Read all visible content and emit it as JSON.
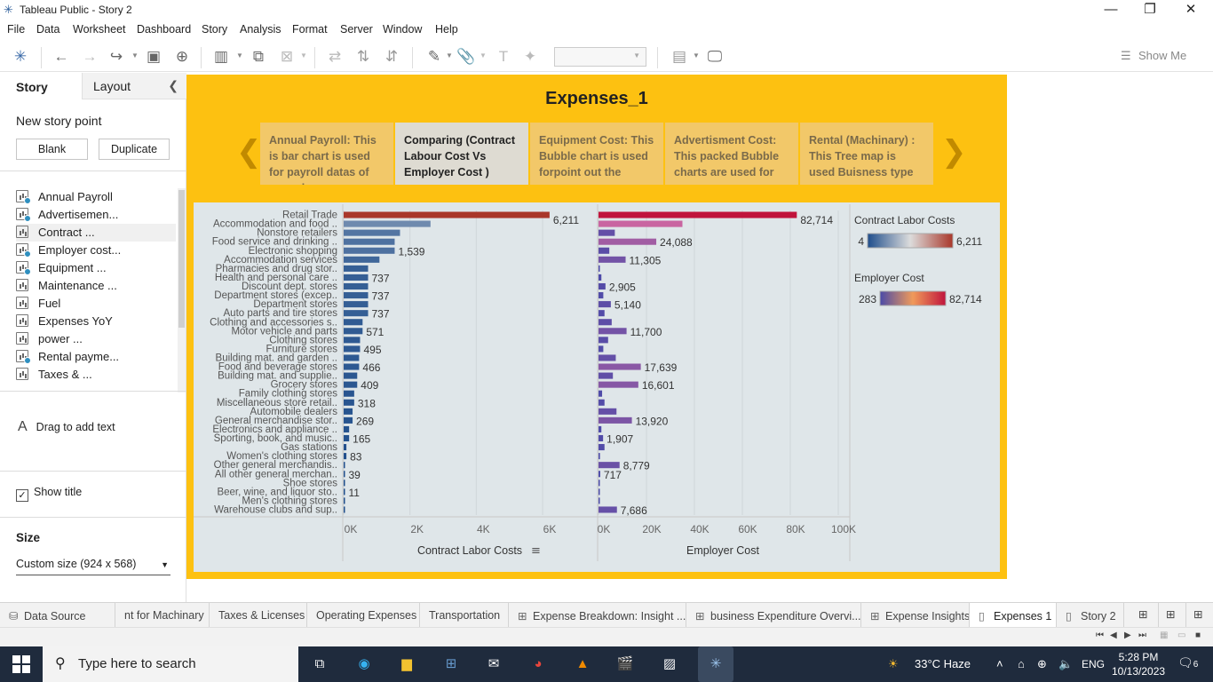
{
  "window": {
    "title": "Tableau Public - Story 2",
    "minimize": "—",
    "restore": "❐",
    "close": "✕"
  },
  "menu": [
    "File",
    "Data",
    "Worksheet",
    "Dashboard",
    "Story",
    "Analysis",
    "Format",
    "Server",
    "Window",
    "Help"
  ],
  "toolbar": {
    "show_me": "Show Me"
  },
  "leftpane": {
    "tab_story": "Story",
    "tab_layout": "Layout",
    "new_story_point": "New story point",
    "blank_button": "Blank",
    "duplicate_button": "Duplicate",
    "sheets": [
      {
        "label": "Annual Payroll",
        "checked": true
      },
      {
        "label": "Advertisemen...",
        "checked": true
      },
      {
        "label": "Contract ...",
        "checked": false
      },
      {
        "label": "Employer cost...",
        "checked": true
      },
      {
        "label": "Equipment ...",
        "checked": true
      },
      {
        "label": "Maintenance ...",
        "checked": false
      },
      {
        "label": "Fuel",
        "checked": false
      },
      {
        "label": "Expenses YoY",
        "checked": false
      },
      {
        "label": "power ...",
        "checked": false
      },
      {
        "label": "Rental payme...",
        "checked": true
      },
      {
        "label": "Taxes & ...",
        "checked": false
      }
    ],
    "drag_text": "Drag to add text",
    "drag_icon": "A",
    "show_title": "Show title",
    "size_label": "Size",
    "size_value": "Custom size (924 x 568)"
  },
  "story": {
    "title": "Expenses_1",
    "points": [
      {
        "text": "Annual Payroll:  This is bar chart is used for payroll datas of annual",
        "active": false
      },
      {
        "text": "Comparing (Contract Labour Cost  Vs Employer Cost )",
        "active": true
      },
      {
        "text": "Equipment Cost:  This Bubble chart is used forpoint out the",
        "active": false
      },
      {
        "text": "Advertisment Cost: This packed Bubble charts are used for",
        "active": false
      },
      {
        "text": "Rental  (Machinary) : This  Tree map is used Buisness type",
        "active": false
      }
    ],
    "prev_arrow": "❮",
    "next_arrow": "❯"
  },
  "chart_data": {
    "type": "bar",
    "categories": [
      "Retail Trade",
      "Accommodation and food ..",
      "Nonstore retailers",
      "Food service and drinking ..",
      "Electronic shopping",
      "Accommodation services",
      "Pharmacies and drug stor..",
      "Health and personal care ..",
      "Discount dept. stores",
      "Department stores (excep..",
      "Department stores",
      "Auto parts and tire stores",
      "Clothing and accessories s..",
      "Motor vehicle and parts",
      "Clothing stores",
      "Furniture stores",
      "Building mat. and garden ..",
      "Food and beverage stores",
      "Building mat. and supplie..",
      "Grocery stores",
      "Family clothing stores",
      "Miscellaneous store retail..",
      "Automobile dealers",
      "General merchandise stor..",
      "Electronics and appliance ..",
      "Sporting, book, and music..",
      "Gas stations",
      "Women's clothing stores",
      "Other general merchandis..",
      "All other general merchan..",
      "Shoe stores",
      "Beer, wine, and liquor sto..",
      "Men's clothing stores",
      "Warehouse clubs and sup.."
    ],
    "series": [
      {
        "name": "Contract Labor Costs",
        "values": [
          6211,
          2620,
          1700,
          1539,
          1539,
          1080,
          737,
          737,
          737,
          737,
          737,
          737,
          571,
          571,
          495,
          495,
          466,
          466,
          409,
          409,
          318,
          318,
          269,
          269,
          165,
          165,
          83,
          83,
          39,
          39,
          11,
          11,
          5,
          4
        ],
        "labels": {
          "0": "6,211",
          "4": "1,539",
          "7": "737",
          "9": "737",
          "11": "737",
          "13": "571",
          "15": "495",
          "17": "466",
          "19": "409",
          "21": "318",
          "23": "269",
          "25": "165",
          "27": "83",
          "29": "39",
          "31": "11"
        }
      },
      {
        "name": "Employer Cost",
        "values": [
          82714,
          35000,
          6800,
          24088,
          4500,
          11305,
          500,
          1200,
          2905,
          2000,
          5140,
          2500,
          5500,
          11700,
          4000,
          2000,
          7200,
          17639,
          6000,
          16601,
          1500,
          2500,
          7500,
          13920,
          1200,
          1907,
          2500,
          600,
          8779,
          717,
          400,
          300,
          283,
          7686
        ],
        "labels": {
          "0": "82,714",
          "3": "24,088",
          "5": "11,305",
          "8": "2,905",
          "10": "5,140",
          "13": "11,700",
          "17": "17,639",
          "19": "16,601",
          "23": "13,920",
          "25": "1,907",
          "28": "8,779",
          "29": "717",
          "33": "7,686"
        }
      }
    ],
    "xlabel_left": "Contract Labor Costs",
    "xlabel_right": "Employer Cost",
    "xticks_left": [
      "0K",
      "2K",
      "4K",
      "6K"
    ],
    "xticks_right": [
      "0K",
      "20K",
      "40K",
      "60K",
      "80K",
      "100K"
    ],
    "xlim_left": [
      0,
      7500
    ],
    "xlim_right": [
      0,
      100000
    ],
    "legend": [
      {
        "title": "Contract Labor Costs",
        "min": "4",
        "max": "6,211"
      },
      {
        "title": "Employer Cost",
        "min": "283",
        "max": "82,714"
      }
    ],
    "colors": {
      "labor_low": "#1f4e8c",
      "labor_mid": "#dcdcdc",
      "labor_high": "#a9372a",
      "emp_low": "#4a4aa8",
      "emp_mid": "#e06aa0",
      "emp_high": "#c0143c"
    }
  },
  "sheettabs": [
    {
      "label": "Data Source",
      "icon": "⛁",
      "active": false
    },
    {
      "label": "nt for Machinary",
      "icon": "",
      "active": false
    },
    {
      "label": "Taxes & Licenses",
      "icon": "",
      "active": false
    },
    {
      "label": "Operating Expenses",
      "icon": "",
      "active": false
    },
    {
      "label": "Transportation",
      "icon": "",
      "active": false
    },
    {
      "label": "Expense Breakdown: Insight ...",
      "icon": "⊞",
      "active": false
    },
    {
      "label": "business Expenditure Overvi...",
      "icon": "⊞",
      "active": false
    },
    {
      "label": "Expense Insights",
      "icon": "⊞",
      "active": false
    },
    {
      "label": "Expenses 1",
      "icon": "▯",
      "active": true
    },
    {
      "label": "Story 2",
      "icon": "▯",
      "active": false
    }
  ],
  "taskbar": {
    "search_placeholder": "Type here to search",
    "weather": "33°C  Haze",
    "lang": "ENG",
    "time": "5:28 PM",
    "date": "10/13/2023",
    "notifications": "6"
  }
}
